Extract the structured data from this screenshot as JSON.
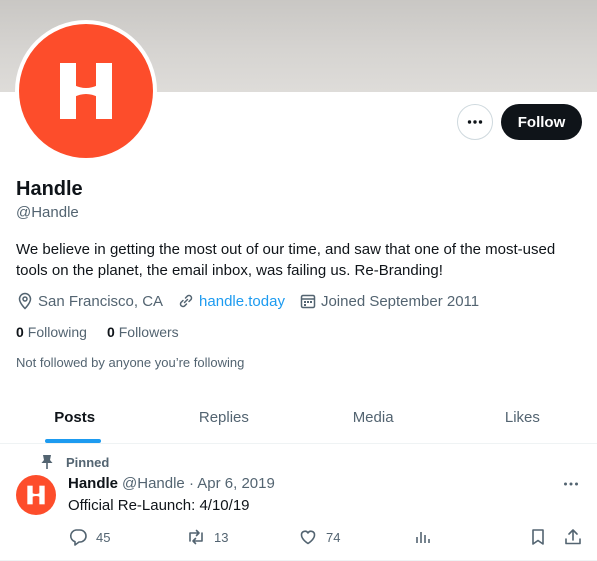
{
  "profile": {
    "name": "Handle",
    "handle": "@Handle",
    "bio": "We believe in getting the most out of our time, and saw that one of the most-used tools on the planet, the email inbox, was failing us. Re-Branding!",
    "location": "San Francisco, CA",
    "website": "handle.today",
    "joined": "Joined September 2011",
    "following_count": "0",
    "following_label": "Following",
    "followers_count": "0",
    "followers_label": "Followers",
    "not_followed": "Not followed by anyone you’re following",
    "avatar_letter": "H",
    "brand_color": "#fd4d2b"
  },
  "actions": {
    "follow_label": "Follow",
    "more_icon": "more-horizontal-icon"
  },
  "tabs": [
    {
      "label": "Posts",
      "active": true
    },
    {
      "label": "Replies",
      "active": false
    },
    {
      "label": "Media",
      "active": false
    },
    {
      "label": "Likes",
      "active": false
    }
  ],
  "tweet": {
    "pinned_label": "Pinned",
    "author_name": "Handle",
    "author_handle": "@Handle · Apr 6, 2019",
    "text": "Official Re-Launch: 4/10/19",
    "replies": "45",
    "retweets": "13",
    "likes": "74"
  },
  "colors": {
    "accent": "#1d9bf0",
    "text": "#0f1419",
    "secondary": "#536471"
  }
}
